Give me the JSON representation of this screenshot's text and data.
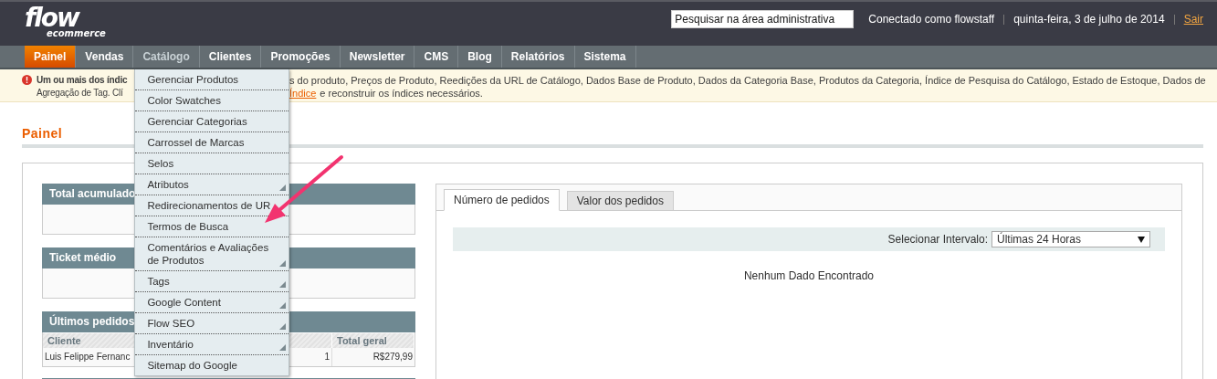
{
  "header": {
    "logo": {
      "name": "flow",
      "tagline": "ecommerce"
    },
    "search": {
      "placeholder": "Pesquisar na área administrativa"
    },
    "user": "Conectado como flowstaff",
    "date": "quinta-feira, 3 de julho de 2014",
    "logout": "Sair"
  },
  "nav": [
    {
      "label": "Painel",
      "selected": true,
      "expanded": false
    },
    {
      "label": "Vendas",
      "selected": false,
      "expanded": false
    },
    {
      "label": "Catálogo",
      "selected": false,
      "expanded": true
    },
    {
      "label": "Clientes",
      "selected": false,
      "expanded": false
    },
    {
      "label": "Promoções",
      "selected": false,
      "expanded": false
    },
    {
      "label": "Newsletter",
      "selected": false,
      "expanded": false
    },
    {
      "label": "CMS",
      "selected": false,
      "expanded": false
    },
    {
      "label": "Blog",
      "selected": false,
      "expanded": false
    },
    {
      "label": "Relatórios",
      "selected": false,
      "expanded": false
    },
    {
      "label": "Sistema",
      "selected": false,
      "expanded": false
    }
  ],
  "dropdown": [
    {
      "label": "Gerenciar Produtos",
      "submenu": false
    },
    {
      "label": "Color Swatches",
      "submenu": false
    },
    {
      "label": "Gerenciar Categorias",
      "submenu": false
    },
    {
      "label": "Carrossel de Marcas",
      "submenu": false
    },
    {
      "label": "Selos",
      "submenu": false
    },
    {
      "label": "Atributos",
      "submenu": true
    },
    {
      "label": "Redirecionamentos de UR",
      "submenu": false
    },
    {
      "label": "Termos de Busca",
      "submenu": false
    },
    {
      "label": "Comentários e Avaliações de Produtos",
      "submenu": true
    },
    {
      "label": "Tags",
      "submenu": true
    },
    {
      "label": "Google Content",
      "submenu": true
    },
    {
      "label": "Flow SEO",
      "submenu": true
    },
    {
      "label": "Inventário",
      "submenu": true
    },
    {
      "label": "Sitemap do Google",
      "submenu": false
    }
  ],
  "notice": {
    "left_lines": [
      "Um ou mais dos índic",
      "Agregação de Tag. Clí"
    ],
    "right_line": "s do produto, Preços de Produto, Reedições da URL de Catálogo, Dados Base de Produto, Dados da Categoria Base, Produtos da Categoria, Índice de Pesquisa do Catálogo, Estado de Estoque, Dados de",
    "link": "Índice",
    "after_link": "e reconstruir os índices necessários."
  },
  "page_title": "Painel",
  "widgets": [
    {
      "title": "Total acumulado"
    },
    {
      "title": "Ticket médio"
    }
  ],
  "last_orders": {
    "title": "Últimos pedidos",
    "columns": {
      "client": "Cliente",
      "total": "Total geral"
    },
    "rows": [
      {
        "client": "Luis Felippe Fernanc",
        "items": "1",
        "total": "R$279,99"
      }
    ]
  },
  "chart_panel": {
    "tabs": [
      {
        "label": "Número de pedidos",
        "selected": true
      },
      {
        "label": "Valor dos pedidos",
        "selected": false
      }
    ],
    "range_label": "Selecionar Intervalo:",
    "range_value": "Últimas 24 Horas",
    "empty": "Nenhum Dado Encontrado"
  }
}
